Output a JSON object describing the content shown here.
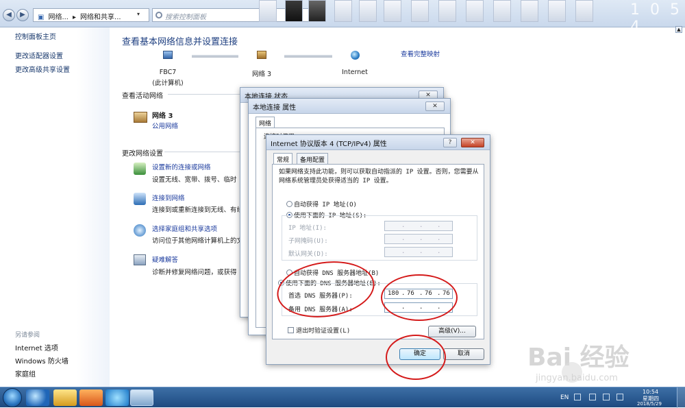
{
  "addressbar": {
    "breadcrumbs": [
      "网络...",
      "网络和共享..."
    ],
    "search_placeholder": "搜索控制面板",
    "clock_fragment": "1 0 5 4"
  },
  "sidebar": {
    "home": "控制面板主页",
    "links": [
      "更改适配器设置",
      "更改高级共享设置"
    ],
    "see_also_header": "另请参阅",
    "see_also": [
      "Internet 选项",
      "Windows 防火墙",
      "家庭组"
    ]
  },
  "main": {
    "title": "查看基本网络信息并设置连接",
    "map": {
      "nodes": [
        {
          "name": "FBC7",
          "sub": "(此计算机)",
          "icon": "computer-icon"
        },
        {
          "name": "网络  3",
          "icon": "bench-network-icon"
        },
        {
          "name": "Internet",
          "icon": "globe-icon"
        }
      ],
      "full_map_link": "查看完整映射"
    },
    "active_header": "查看活动网络",
    "active_network": {
      "name": "网络  3",
      "type": "公用网络"
    },
    "change_header": "更改网络设置",
    "tasks": [
      {
        "title": "设置新的连接或网络",
        "desc": "设置无线、宽带、拨号、临时",
        "icon": "new-connection-icon"
      },
      {
        "title": "连接到网络",
        "desc": "连接到或重新连接到无线、有线",
        "icon": "connect-network-icon"
      },
      {
        "title": "选择家庭组和共享选项",
        "desc": "访问位于其他网络计算机上的文",
        "icon": "homegroup-icon"
      },
      {
        "title": "疑难解答",
        "desc": "诊断并修复网络问题，或获得",
        "icon": "troubleshoot-icon"
      }
    ]
  },
  "status_window": {
    "title": "本地连接 状态",
    "close": "✕"
  },
  "props_window": {
    "title": "本地连接 属性",
    "tab": "网络",
    "connect_using": "连接时使用:",
    "close": "✕"
  },
  "ipv4_dialog": {
    "title": "Internet 协议版本 4 (TCP/IPv4) 属性",
    "help": "?",
    "close": "✕",
    "tabs": [
      "常规",
      "备用配置"
    ],
    "description": "如果网络支持此功能，则可以获取自动指派的 IP 设置。否则，您需要从网络系统管理员处获得适当的 IP 设置。",
    "auto_ip": "自动获得 IP 地址(O)",
    "manual_ip": "使用下面的 IP 地址(S):",
    "ip_label": "IP 地址(I):",
    "mask_label": "子网掩码(U):",
    "gateway_label": "默认网关(D):",
    "auto_dns": "自动获得 DNS 服务器地址(B)",
    "manual_dns": "使用下面的 DNS 服务器地址(E):",
    "preferred_dns_label": "首选 DNS 服务器(P):",
    "preferred_dns": [
      "180",
      "76",
      "76",
      "76"
    ],
    "alternate_dns_label": "备用 DNS 服务器(A):",
    "validate_label": "退出时验证设置(L)",
    "advanced": "高级(V)...",
    "ok": "确定",
    "cancel": "取消",
    "ip_mode": "manual",
    "dns_mode": "manual",
    "validate_checked": false
  },
  "taskbar": {
    "lang": "EN",
    "time": "10:54",
    "weekday": "星期四",
    "date": "2018/5/29"
  },
  "watermark": {
    "brand": "Bai  经验",
    "url": "jingyan.baidu.com"
  },
  "colors": {
    "annotation": "#d41a1a",
    "link": "#1a3a9d",
    "title": "#1e3f80"
  }
}
